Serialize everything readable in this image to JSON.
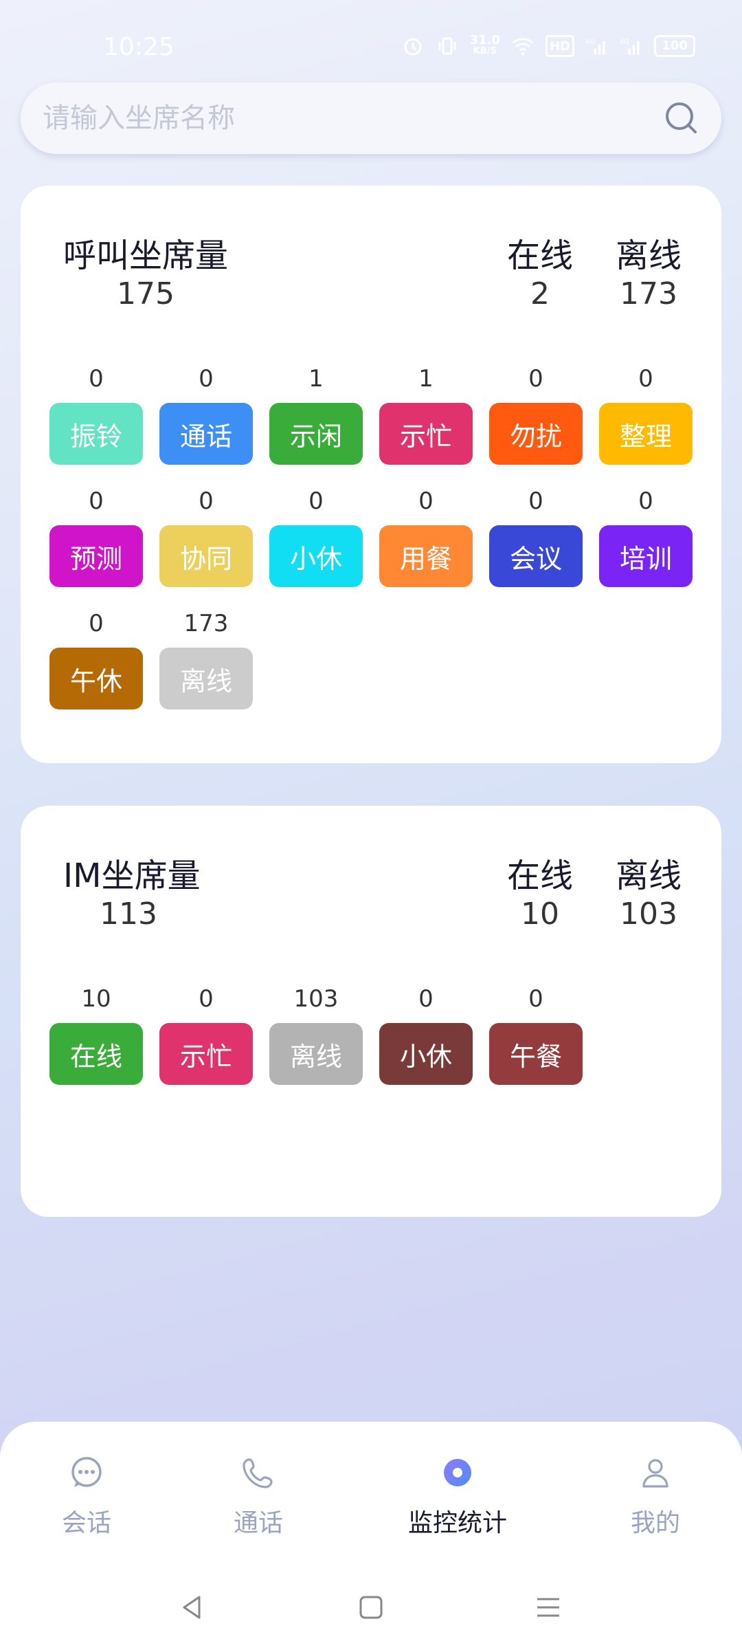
{
  "status_bar": {
    "time": "10:25",
    "net_speed_top": "31.0",
    "net_speed_bottom": "KB/S",
    "hd_label": "HD",
    "signal_1_label": "4G",
    "signal_2_label": "4G",
    "battery": "100"
  },
  "search": {
    "placeholder": "请输入坐席名称"
  },
  "call_card": {
    "total_label": "呼叫坐席量",
    "total_value": "175",
    "online_label": "在线",
    "online_value": "2",
    "offline_label": "离线",
    "offline_value": "173",
    "statuses": [
      {
        "label": "振铃",
        "count": "0",
        "color": "#62e3c3"
      },
      {
        "label": "通话",
        "count": "0",
        "color": "#3d8ff5"
      },
      {
        "label": "示闲",
        "count": "1",
        "color": "#3aac3a"
      },
      {
        "label": "示忙",
        "count": "1",
        "color": "#e0336d"
      },
      {
        "label": "勿扰",
        "count": "0",
        "color": "#ff5a10"
      },
      {
        "label": "整理",
        "count": "0",
        "color": "#ffba00"
      },
      {
        "label": "预测",
        "count": "0",
        "color": "#cf14c9"
      },
      {
        "label": "协同",
        "count": "0",
        "color": "#edd05c"
      },
      {
        "label": "小休",
        "count": "0",
        "color": "#12def3"
      },
      {
        "label": "用餐",
        "count": "0",
        "color": "#ff8835"
      },
      {
        "label": "会议",
        "count": "0",
        "color": "#3a48d8"
      },
      {
        "label": "培训",
        "count": "0",
        "color": "#7a25f6"
      },
      {
        "label": "午休",
        "count": "0",
        "color": "#b66a05"
      },
      {
        "label": "离线",
        "count": "173",
        "color": "#cccccc"
      }
    ]
  },
  "im_card": {
    "total_label": "IM坐席量",
    "total_value": "113",
    "online_label": "在线",
    "online_value": "10",
    "offline_label": "离线",
    "offline_value": "103",
    "statuses": [
      {
        "label": "在线",
        "count": "10",
        "color": "#3aac3a"
      },
      {
        "label": "示忙",
        "count": "0",
        "color": "#e0336d"
      },
      {
        "label": "离线",
        "count": "103",
        "color": "#b3b3b3"
      },
      {
        "label": "小休",
        "count": "0",
        "color": "#7a3a3a"
      },
      {
        "label": "午餐",
        "count": "0",
        "color": "#943b3d"
      }
    ]
  },
  "bottom_nav": {
    "items": [
      {
        "label": "会话",
        "icon": "chat-bubble-icon"
      },
      {
        "label": "通话",
        "icon": "phone-icon"
      },
      {
        "label": "监控统计",
        "icon": "monitor-icon"
      },
      {
        "label": "我的",
        "icon": "user-icon"
      }
    ],
    "active_color": "#5b7cf6",
    "inactive_color": "#9aa4c0"
  }
}
